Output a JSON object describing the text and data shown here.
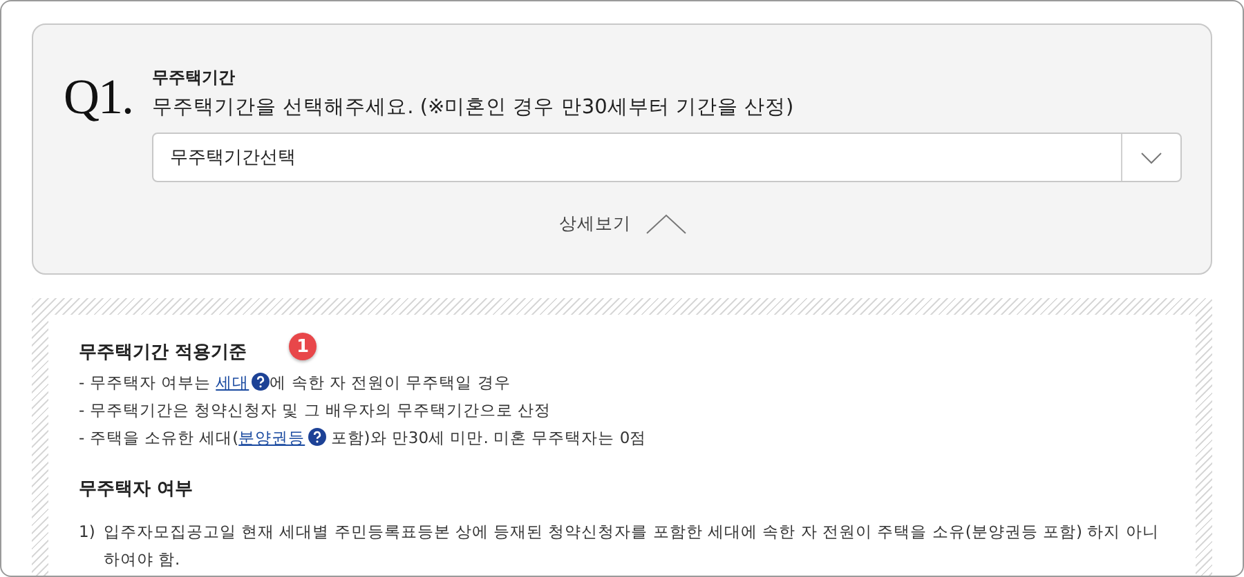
{
  "question": {
    "number": "Q1.",
    "label": "무주택기간",
    "text": "무주택기간을 선택해주세요. (※미혼인 경우 만30세부터 기간을 산정)",
    "select": {
      "value": "무주택기간선택"
    },
    "details_toggle": {
      "label": "상세보기",
      "expanded": true
    }
  },
  "details": {
    "sections": [
      {
        "heading": "무주택기간 적용기준",
        "kind": "bullets",
        "items": [
          {
            "segments": [
              {
                "kind": "text",
                "text": "- 무주택자 여부는 "
              },
              {
                "kind": "link",
                "text": "세대",
                "help": true
              },
              {
                "kind": "text",
                "text": "에 속한 자 전원이 무주택일 경우"
              }
            ]
          },
          {
            "segments": [
              {
                "kind": "text",
                "text": "- 무주택기간은 청약신청자 및 그 배우자의 무주택기간으로 산정"
              }
            ]
          },
          {
            "segments": [
              {
                "kind": "text",
                "text": "- 주택을 소유한 세대("
              },
              {
                "kind": "link",
                "text": "분양권등",
                "help": true
              },
              {
                "kind": "text",
                "text": " 포함)와 만30세 미만. 미혼 무주택자는 0점"
              }
            ]
          }
        ]
      },
      {
        "heading": "무주택자 여부",
        "kind": "numbered",
        "items": [
          {
            "number": "1)",
            "segments": [
              {
                "kind": "text",
                "text": "입주자모집공고일 현재 세대별 주민등록표등본 상에 등재된 청약신청자를 포함한 세대에 속한 자 전원이 주택을 소유(분양권등 포함) 하지 아니하여야 함."
              }
            ]
          }
        ]
      }
    ],
    "callout": {
      "label": "1"
    }
  }
}
